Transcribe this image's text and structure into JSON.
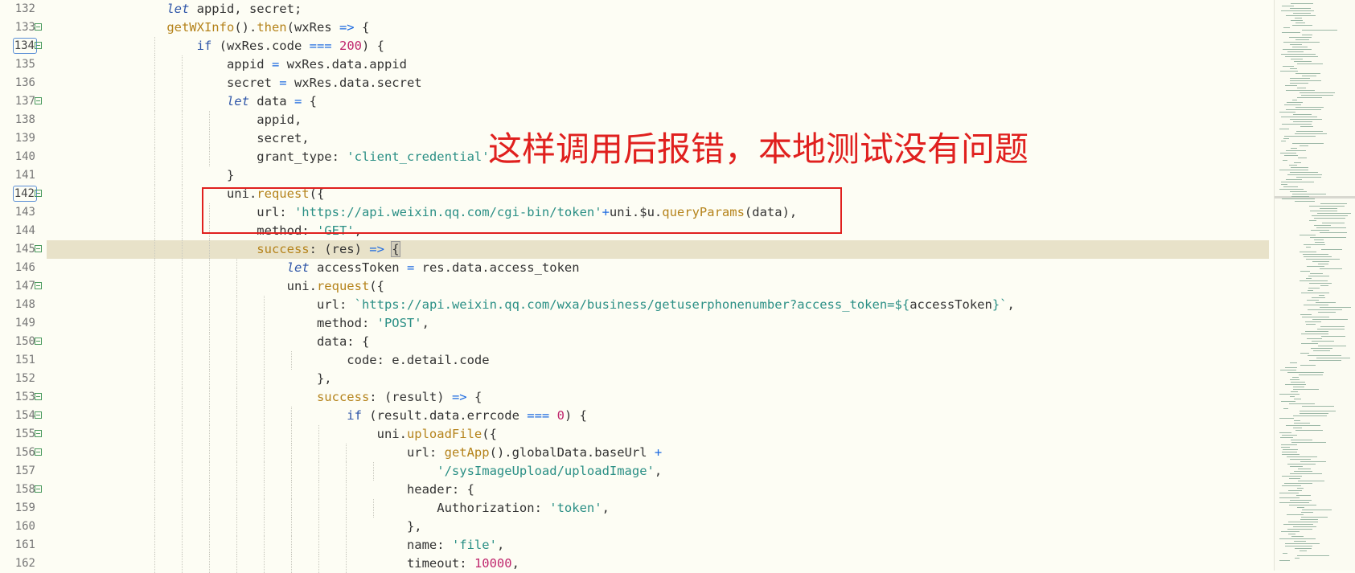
{
  "editor": {
    "lines": [
      {
        "n": "132",
        "fold": false,
        "boxed": false,
        "hl": false,
        "indent": 4,
        "tokens": [
          [
            "kw",
            "let"
          ],
          [
            "p",
            " appid, secret;"
          ]
        ]
      },
      {
        "n": "133",
        "fold": true,
        "boxed": false,
        "hl": false,
        "indent": 4,
        "tokens": [
          [
            "fn",
            "getWXInfo"
          ],
          [
            "p",
            "()."
          ],
          [
            "fn",
            "then"
          ],
          [
            "p",
            "(wxRes "
          ],
          [
            "op",
            "=>"
          ],
          [
            "p",
            " {"
          ]
        ]
      },
      {
        "n": "134",
        "fold": true,
        "boxed": true,
        "hl": false,
        "indent": 5,
        "tokens": [
          [
            "ctl",
            "if"
          ],
          [
            "p",
            " (wxRes.code "
          ],
          [
            "op",
            "==="
          ],
          [
            "p",
            " "
          ],
          [
            "num",
            "200"
          ],
          [
            "p",
            ") {"
          ]
        ]
      },
      {
        "n": "135",
        "fold": false,
        "boxed": false,
        "hl": false,
        "indent": 6,
        "tokens": [
          [
            "p",
            "appid "
          ],
          [
            "op",
            "="
          ],
          [
            "p",
            " wxRes.data.appid"
          ]
        ]
      },
      {
        "n": "136",
        "fold": false,
        "boxed": false,
        "hl": false,
        "indent": 6,
        "tokens": [
          [
            "p",
            "secret "
          ],
          [
            "op",
            "="
          ],
          [
            "p",
            " wxRes.data.secret"
          ]
        ]
      },
      {
        "n": "137",
        "fold": true,
        "boxed": false,
        "hl": false,
        "indent": 6,
        "tokens": [
          [
            "kw",
            "let"
          ],
          [
            "p",
            " data "
          ],
          [
            "op",
            "="
          ],
          [
            "p",
            " {"
          ]
        ]
      },
      {
        "n": "138",
        "fold": false,
        "boxed": false,
        "hl": false,
        "indent": 7,
        "tokens": [
          [
            "p",
            "appid,"
          ]
        ]
      },
      {
        "n": "139",
        "fold": false,
        "boxed": false,
        "hl": false,
        "indent": 7,
        "tokens": [
          [
            "p",
            "secret,"
          ]
        ]
      },
      {
        "n": "140",
        "fold": false,
        "boxed": false,
        "hl": false,
        "indent": 7,
        "tokens": [
          [
            "p",
            "grant_type: "
          ],
          [
            "str",
            "'client_credential'"
          ]
        ]
      },
      {
        "n": "141",
        "fold": false,
        "boxed": false,
        "hl": false,
        "indent": 6,
        "tokens": [
          [
            "p",
            "}"
          ]
        ]
      },
      {
        "n": "142",
        "fold": true,
        "boxed": true,
        "hl": false,
        "indent": 6,
        "tokens": [
          [
            "p",
            "uni."
          ],
          [
            "fn",
            "request"
          ],
          [
            "p",
            "({"
          ]
        ]
      },
      {
        "n": "143",
        "fold": false,
        "boxed": false,
        "hl": false,
        "indent": 7,
        "tokens": [
          [
            "p",
            "url: "
          ],
          [
            "str",
            "'https://api.weixin.qq.com/cgi-bin/token'"
          ],
          [
            "op",
            "+"
          ],
          [
            "p",
            "uni.$u."
          ],
          [
            "fn",
            "queryParams"
          ],
          [
            "p",
            "(data),"
          ]
        ]
      },
      {
        "n": "144",
        "fold": false,
        "boxed": false,
        "hl": false,
        "indent": 7,
        "tokens": [
          [
            "p",
            "method: "
          ],
          [
            "str",
            "'GET'"
          ],
          [
            "p",
            ","
          ]
        ]
      },
      {
        "n": "145",
        "fold": true,
        "boxed": false,
        "hl": true,
        "indent": 7,
        "tokens": [
          [
            "fn",
            "success"
          ],
          [
            "p",
            ": (res) "
          ],
          [
            "op",
            "=>"
          ],
          [
            "p",
            " "
          ],
          [
            "cur",
            "{"
          ]
        ]
      },
      {
        "n": "146",
        "fold": false,
        "boxed": false,
        "hl": false,
        "indent": 8,
        "tokens": [
          [
            "kw",
            "let"
          ],
          [
            "p",
            " accessToken "
          ],
          [
            "op",
            "="
          ],
          [
            "p",
            " res.data.access_token"
          ]
        ]
      },
      {
        "n": "147",
        "fold": true,
        "boxed": false,
        "hl": false,
        "indent": 8,
        "tokens": [
          [
            "p",
            "uni."
          ],
          [
            "fn",
            "request"
          ],
          [
            "p",
            "({"
          ]
        ]
      },
      {
        "n": "148",
        "fold": false,
        "boxed": false,
        "hl": false,
        "indent": 9,
        "tokens": [
          [
            "p",
            "url: "
          ],
          [
            "str",
            "`https://api.weixin.qq.com/wxa/business/getuserphonenumber?access_token=${"
          ],
          [
            "p",
            "accessToken"
          ],
          [
            "str",
            "}`"
          ],
          [
            "p",
            ","
          ]
        ]
      },
      {
        "n": "149",
        "fold": false,
        "boxed": false,
        "hl": false,
        "indent": 9,
        "tokens": [
          [
            "p",
            "method: "
          ],
          [
            "str",
            "'POST'"
          ],
          [
            "p",
            ","
          ]
        ]
      },
      {
        "n": "150",
        "fold": true,
        "boxed": false,
        "hl": false,
        "indent": 9,
        "tokens": [
          [
            "p",
            "data: {"
          ]
        ]
      },
      {
        "n": "151",
        "fold": false,
        "boxed": false,
        "hl": false,
        "indent": 10,
        "tokens": [
          [
            "p",
            "code: e.detail.code"
          ]
        ]
      },
      {
        "n": "152",
        "fold": false,
        "boxed": false,
        "hl": false,
        "indent": 9,
        "tokens": [
          [
            "p",
            "},"
          ]
        ]
      },
      {
        "n": "153",
        "fold": true,
        "boxed": false,
        "hl": false,
        "indent": 9,
        "tokens": [
          [
            "fn",
            "success"
          ],
          [
            "p",
            ": (result) "
          ],
          [
            "op",
            "=>"
          ],
          [
            "p",
            " {"
          ]
        ]
      },
      {
        "n": "154",
        "fold": true,
        "boxed": false,
        "hl": false,
        "indent": 10,
        "tokens": [
          [
            "ctl",
            "if"
          ],
          [
            "p",
            " (result.data.errcode "
          ],
          [
            "op",
            "==="
          ],
          [
            "p",
            " "
          ],
          [
            "num",
            "0"
          ],
          [
            "p",
            ") {"
          ]
        ]
      },
      {
        "n": "155",
        "fold": true,
        "boxed": false,
        "hl": false,
        "indent": 11,
        "tokens": [
          [
            "p",
            "uni."
          ],
          [
            "fn",
            "uploadFile"
          ],
          [
            "p",
            "({"
          ]
        ]
      },
      {
        "n": "156",
        "fold": true,
        "boxed": false,
        "hl": false,
        "indent": 12,
        "tokens": [
          [
            "p",
            "url: "
          ],
          [
            "fn",
            "getApp"
          ],
          [
            "p",
            "().globalData.baseUrl "
          ],
          [
            "op",
            "+"
          ]
        ]
      },
      {
        "n": "157",
        "fold": false,
        "boxed": false,
        "hl": false,
        "indent": 13,
        "tokens": [
          [
            "str",
            "'/sysImageUpload/uploadImage'"
          ],
          [
            "p",
            ","
          ]
        ]
      },
      {
        "n": "158",
        "fold": true,
        "boxed": false,
        "hl": false,
        "indent": 12,
        "tokens": [
          [
            "p",
            "header: {"
          ]
        ]
      },
      {
        "n": "159",
        "fold": false,
        "boxed": false,
        "hl": false,
        "indent": 13,
        "tokens": [
          [
            "p",
            "Authorization: "
          ],
          [
            "str",
            "'token'"
          ],
          [
            "p",
            ","
          ]
        ]
      },
      {
        "n": "160",
        "fold": false,
        "boxed": false,
        "hl": false,
        "indent": 12,
        "tokens": [
          [
            "p",
            "},"
          ]
        ]
      },
      {
        "n": "161",
        "fold": false,
        "boxed": false,
        "hl": false,
        "indent": 12,
        "tokens": [
          [
            "p",
            "name: "
          ],
          [
            "str",
            "'file'"
          ],
          [
            "p",
            ","
          ]
        ]
      },
      {
        "n": "162",
        "fold": false,
        "boxed": false,
        "hl": false,
        "indent": 12,
        "tokens": [
          [
            "p",
            "timeout: "
          ],
          [
            "num",
            "10000"
          ],
          [
            "p",
            ","
          ]
        ]
      }
    ]
  },
  "annotation": {
    "text": "这样调用后报错，本地测试没有问题",
    "color": "#e0201e"
  }
}
